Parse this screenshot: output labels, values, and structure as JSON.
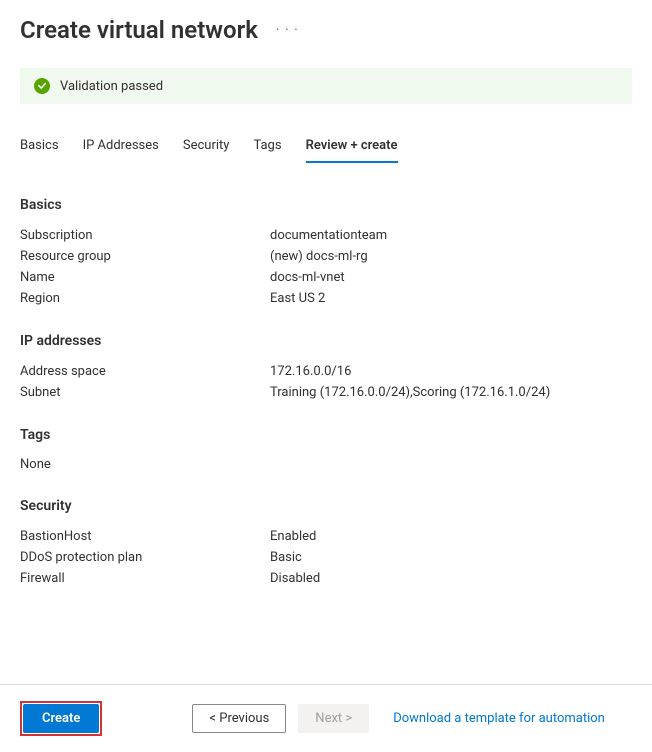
{
  "header": {
    "title": "Create virtual network"
  },
  "validation": {
    "message": "Validation passed"
  },
  "tabs": {
    "basics": "Basics",
    "ip": "IP Addresses",
    "security": "Security",
    "tags": "Tags",
    "review": "Review + create"
  },
  "sections": {
    "basics": {
      "header": "Basics",
      "rows": {
        "subscription_label": "Subscription",
        "subscription_value": "documentationteam",
        "resource_group_label": "Resource group",
        "resource_group_value": "(new) docs-ml-rg",
        "name_label": "Name",
        "name_value": "docs-ml-vnet",
        "region_label": "Region",
        "region_value": "East US 2"
      }
    },
    "ip": {
      "header": "IP addresses",
      "rows": {
        "address_space_label": "Address space",
        "address_space_value": "172.16.0.0/16",
        "subnet_label": "Subnet",
        "subnet_value": "Training (172.16.0.0/24),Scoring (172.16.1.0/24)"
      }
    },
    "tags": {
      "header": "Tags",
      "none": "None"
    },
    "security": {
      "header": "Security",
      "rows": {
        "bastion_label": "BastionHost",
        "bastion_value": "Enabled",
        "ddos_label": "DDoS protection plan",
        "ddos_value": "Basic",
        "firewall_label": "Firewall",
        "firewall_value": "Disabled"
      }
    }
  },
  "footer": {
    "create": "Create",
    "previous": "< Previous",
    "next": "Next >",
    "download_link": "Download a template for automation"
  }
}
